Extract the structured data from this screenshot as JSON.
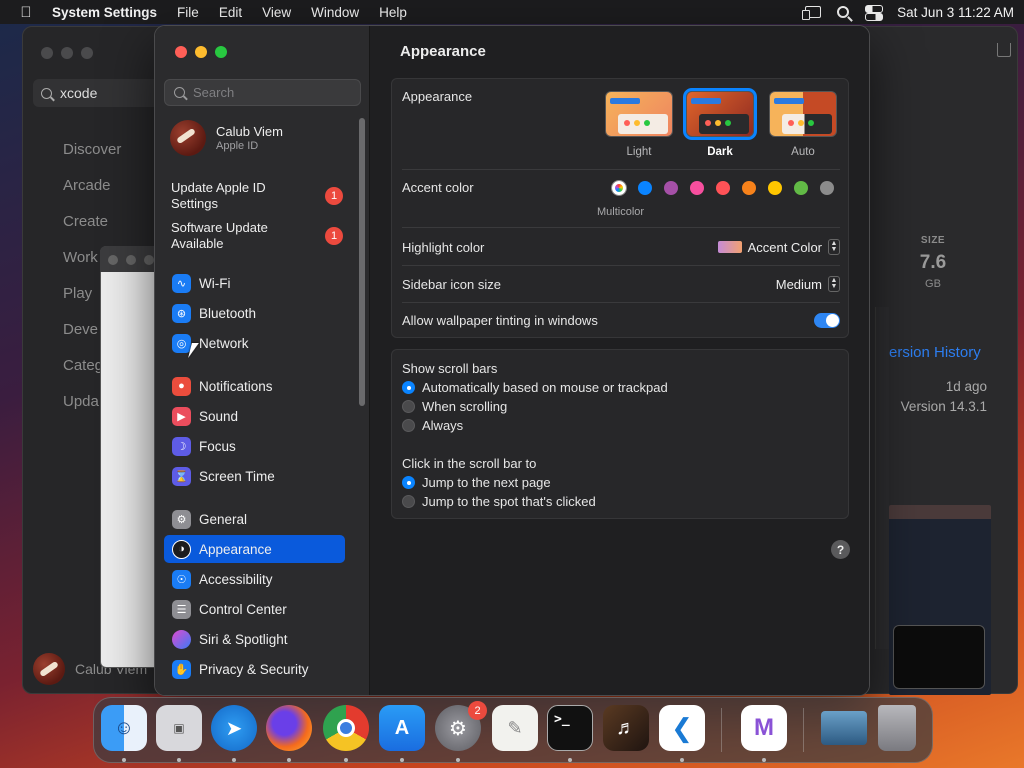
{
  "menubar": {
    "app_name": "System Settings",
    "items": [
      "File",
      "Edit",
      "View",
      "Window",
      "Help"
    ],
    "clock": "Sat Jun 3  11:22 AM"
  },
  "appstore": {
    "search_value": "xcode",
    "nav": [
      "Discover",
      "Arcade",
      "Create",
      "Work",
      "Play",
      "Deve",
      "Categ",
      "Upda"
    ],
    "user_name": "Calub Viem",
    "size_label": "SIZE",
    "size_value": "7.6",
    "size_unit": "GB",
    "version_history": "ersion History",
    "updated_ago": "1d ago",
    "version": "Version 14.3.1"
  },
  "sidebar": {
    "search_placeholder": "Search",
    "profile": {
      "name": "Calub Viem",
      "subtitle": "Apple ID"
    },
    "alerts": [
      {
        "label": "Update Apple ID\nSettings",
        "badge": "1"
      },
      {
        "label": "Software Update\nAvailable",
        "badge": "1"
      }
    ],
    "items": [
      {
        "label": "Wi-Fi",
        "icon": "wifi-icon",
        "color": "#1a7cf5"
      },
      {
        "label": "Bluetooth",
        "icon": "bluetooth-icon",
        "color": "#1a7cf5"
      },
      {
        "label": "Network",
        "icon": "network-icon",
        "color": "#1a7cf5"
      },
      {
        "label": "Notifications",
        "icon": "bell-icon",
        "color": "#eb4d3d"
      },
      {
        "label": "Sound",
        "icon": "speaker-icon",
        "color": "#eb4d5d"
      },
      {
        "label": "Focus",
        "icon": "moon-icon",
        "color": "#5e5ce6"
      },
      {
        "label": "Screen Time",
        "icon": "hourglass-icon",
        "color": "#5e5ce6"
      },
      {
        "label": "General",
        "icon": "gear-icon",
        "color": "#8e8e93"
      },
      {
        "label": "Appearance",
        "icon": "appearance-icon",
        "color": "#1c1c1e"
      },
      {
        "label": "Accessibility",
        "icon": "accessibility-icon",
        "color": "#1a7cf5"
      },
      {
        "label": "Control Center",
        "icon": "control-center-icon",
        "color": "#8e8e93"
      },
      {
        "label": "Siri & Spotlight",
        "icon": "siri-icon",
        "color": "#b04fd6"
      },
      {
        "label": "Privacy & Security",
        "icon": "hand-icon",
        "color": "#1a7cf5"
      }
    ]
  },
  "main": {
    "title": "Appearance",
    "appearance_label": "Appearance",
    "themes": [
      {
        "label": "Light",
        "selected": false
      },
      {
        "label": "Dark",
        "selected": true
      },
      {
        "label": "Auto",
        "selected": false
      }
    ],
    "accent_label": "Accent color",
    "accent_colors": [
      "multicolor",
      "#0a84ff",
      "#a550a7",
      "#f74f9e",
      "#ff5257",
      "#f7821b",
      "#ffc600",
      "#62ba46",
      "#8c8c8c"
    ],
    "accent_selected_label": "Multicolor",
    "highlight_label": "Highlight color",
    "highlight_value": "Accent Color",
    "sidebar_icon_label": "Sidebar icon size",
    "sidebar_icon_value": "Medium",
    "tinting_label": "Allow wallpaper tinting in windows",
    "scroll_title": "Show scroll bars",
    "scroll_options": [
      "Automatically based on mouse or trackpad",
      "When scrolling",
      "Always"
    ],
    "click_title": "Click in the scroll bar to",
    "click_options": [
      "Jump to the next page",
      "Jump to the spot that's clicked"
    ],
    "help": "?"
  },
  "dock": {
    "settings_badge": "2",
    "terminal_prompt": ">_"
  }
}
